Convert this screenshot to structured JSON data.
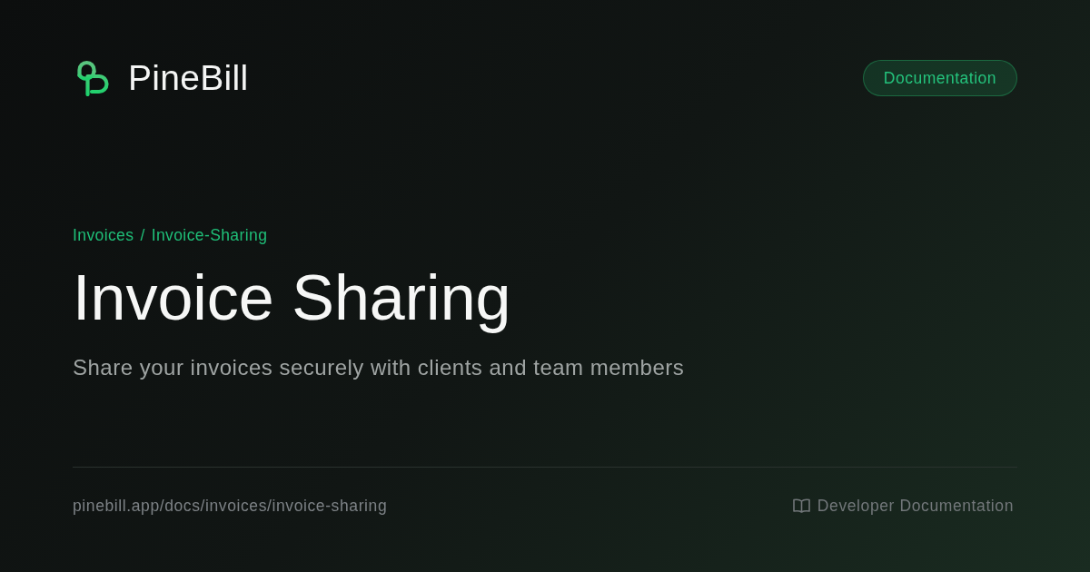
{
  "brand": {
    "name": "PineBill"
  },
  "header_button": {
    "label": "Documentation"
  },
  "breadcrumb": {
    "items": [
      "Invoices",
      "Invoice-Sharing"
    ],
    "separator": "/"
  },
  "title": "Invoice Sharing",
  "subtitle": "Share your invoices securely with clients and team members",
  "footer": {
    "url": "pinebill.app/docs/invoices/invoice-sharing",
    "link": {
      "label": "Developer Documentation"
    }
  }
}
